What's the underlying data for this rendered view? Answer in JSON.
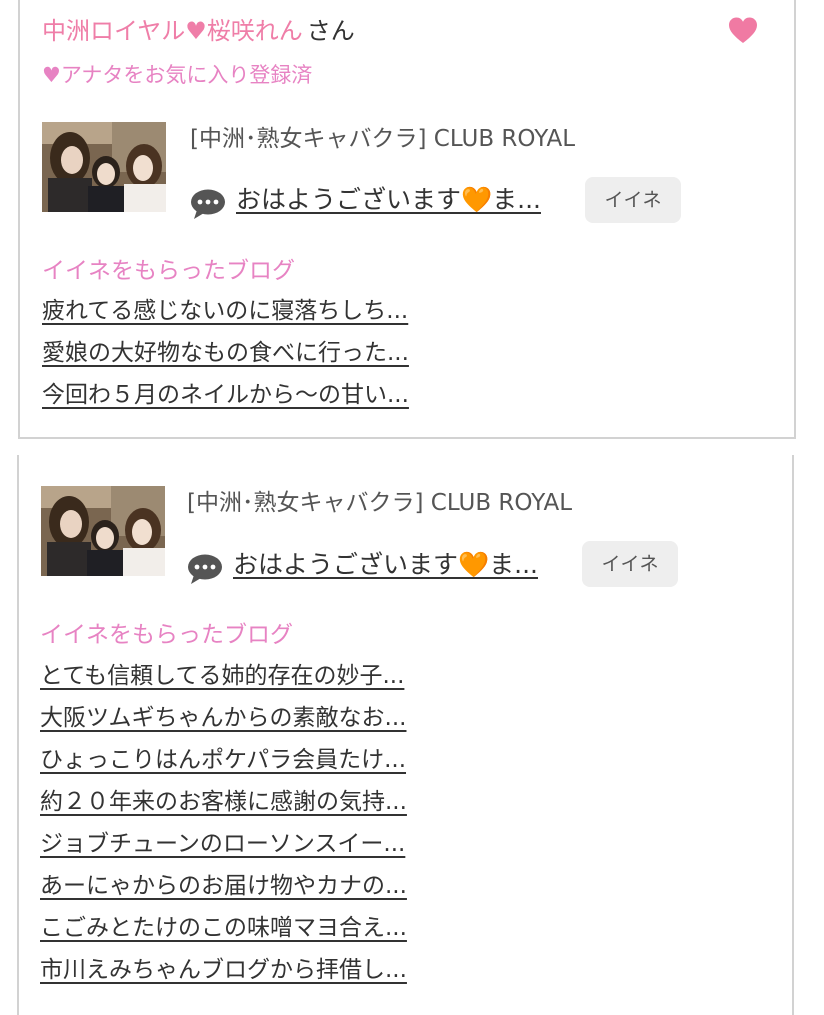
{
  "card1": {
    "cast_name": "中洲ロイヤル♥桜咲れん",
    "honorific": "さん",
    "favorite_status": "♥アナタをお気に入り登録済",
    "heart_icon": "heart-icon",
    "shop_name": "[中洲･熟女キャバクラ]  CLUB ROYAL",
    "message_icon": "speech-bubble-icon",
    "message": "おはようございます🧡ま...",
    "like_button": "イイネ",
    "blog_heading": "イイネをもらったブログ",
    "blogs": [
      "疲れてる感じないのに寝落ちしち...",
      "愛娘の大好物なもの食べに行った...",
      "今回わ５月のネイルから〜の甘い..."
    ]
  },
  "card2": {
    "shop_name": "[中洲･熟女キャバクラ]  CLUB ROYAL",
    "message_icon": "speech-bubble-icon",
    "message": "おはようございます🧡ま...",
    "like_button": "イイネ",
    "blog_heading": "イイネをもらったブログ",
    "blogs": [
      "とても信頼してる姉的存在の妙子...",
      "大阪ツムギちゃんからの素敵なお...",
      "ひょっこりはんポケパラ会員たけ...",
      "約２０年来のお客様に感謝の気持...",
      "ジョブチューンのローソンスイー...",
      "あーにゃからのお届け物やカナの...",
      "こごみとたけのこの味噌マヨ合え...",
      "市川えみちゃんブログから拝借し..."
    ]
  },
  "colors": {
    "accent_pink": "#ef7ea8",
    "heading_pink": "#e783c3",
    "button_bg": "#eeeeee",
    "border": "#d2d2d2"
  }
}
